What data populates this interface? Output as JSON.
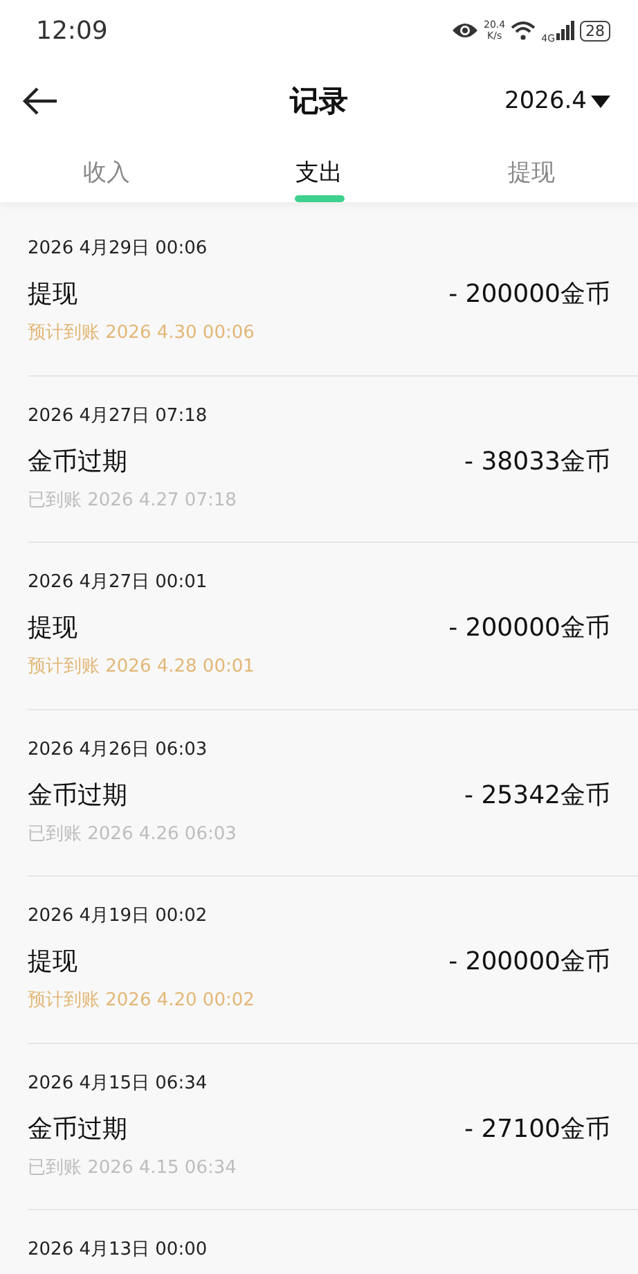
{
  "status_bar": {
    "time": "12:09",
    "speed": "20.4",
    "speed_unit": "K/s",
    "network": "4G",
    "battery": "28"
  },
  "header": {
    "title": "记录",
    "month": "2026.4"
  },
  "tabs": [
    {
      "label": "收入",
      "selected": false
    },
    {
      "label": "支出",
      "selected": true
    },
    {
      "label": "提现",
      "selected": false
    }
  ],
  "records": [
    {
      "date": "2026 4月29日 00:06",
      "title": "提现",
      "amount": "- 200000金币",
      "note": "预计到账 2026 4.30 00:06",
      "kind": "pending"
    },
    {
      "date": "2026 4月27日 07:18",
      "title": "金币过期",
      "amount": "- 38033金币",
      "note": "已到账 2026 4.27 07:18",
      "kind": "done"
    },
    {
      "date": "2026 4月27日 00:01",
      "title": "提现",
      "amount": "- 200000金币",
      "note": "预计到账 2026 4.28 00:01",
      "kind": "pending"
    },
    {
      "date": "2026 4月26日 06:03",
      "title": "金币过期",
      "amount": "- 25342金币",
      "note": "已到账 2026 4.26 06:03",
      "kind": "done"
    },
    {
      "date": "2026 4月19日 00:02",
      "title": "提现",
      "amount": "- 200000金币",
      "note": "预计到账 2026 4.20 00:02",
      "kind": "pending"
    },
    {
      "date": "2026 4月15日 06:34",
      "title": "金币过期",
      "amount": "- 27100金币",
      "note": "已到账 2026 4.15 06:34",
      "kind": "done"
    },
    {
      "date": "2026 4月13日 00:00"
    }
  ]
}
